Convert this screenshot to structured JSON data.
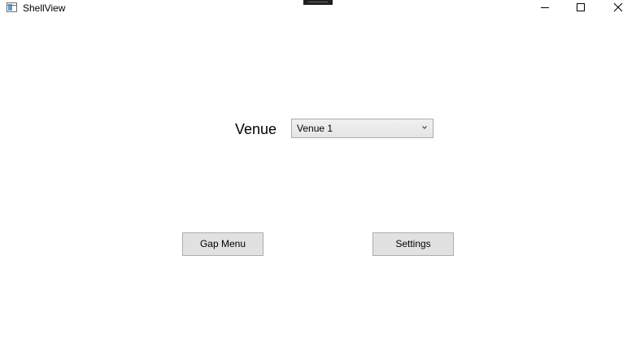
{
  "window": {
    "title": "ShellView"
  },
  "venue": {
    "label": "Venue",
    "selected": "Venue 1"
  },
  "buttons": {
    "gap_menu": "Gap Menu",
    "settings": "Settings"
  }
}
